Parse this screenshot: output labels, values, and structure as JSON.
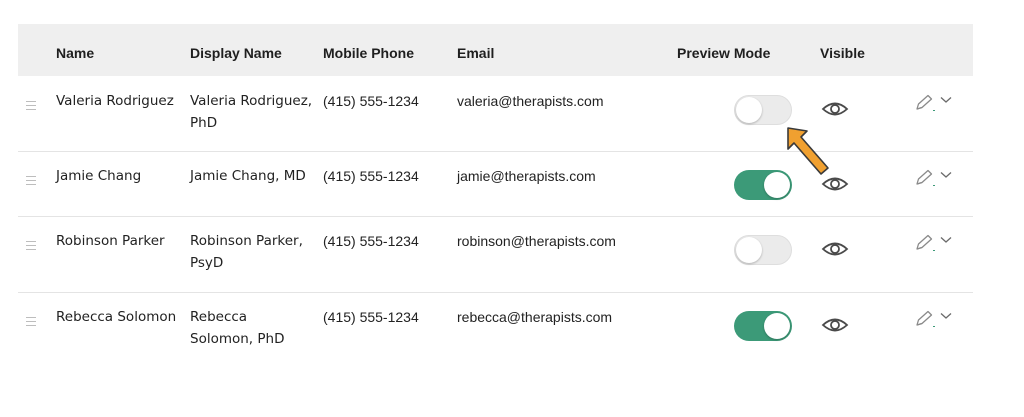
{
  "columns": {
    "name": "Name",
    "display_name": "Display Name",
    "mobile_phone": "Mobile Phone",
    "email": "Email",
    "preview_mode": "Preview Mode",
    "visible": "Visible"
  },
  "rows": [
    {
      "name": "Valeria Rodriguez",
      "display_line1": "Valeria Rodriguez,",
      "display_line2": "PhD",
      "phone": "(415) 555-1234",
      "email": "valeria@therapists.com",
      "preview_mode": false
    },
    {
      "name": "Jamie Chang",
      "display_line1": "Jamie Chang, MD",
      "display_line2": "",
      "phone": "(415) 555-1234",
      "email": "jamie@therapists.com",
      "preview_mode": true
    },
    {
      "name": "Robinson Parker",
      "display_line1": "Robinson Parker,",
      "display_line2": "PsyD",
      "phone": "(415) 555-1234",
      "email": "robinson@therapists.com",
      "preview_mode": false
    },
    {
      "name": "Rebecca Solomon",
      "display_line1": "Rebecca",
      "display_line2": "Solomon, PhD",
      "phone": "(415) 555-1234",
      "email": "rebecca@therapists.com",
      "preview_mode": true
    }
  ],
  "colors": {
    "toggle_on": "#3c9a78",
    "toggle_off": "#ebebeb",
    "header_bg": "#efefef",
    "annotation_arrow": "#f0a030",
    "icon": "#4a4a4a"
  },
  "icons": {
    "row_handle": "drag-handle-icon",
    "visible": "eye-icon",
    "edit": "pencil-icon",
    "menu": "chevron-down-icon",
    "annotation": "arrow-icon"
  }
}
